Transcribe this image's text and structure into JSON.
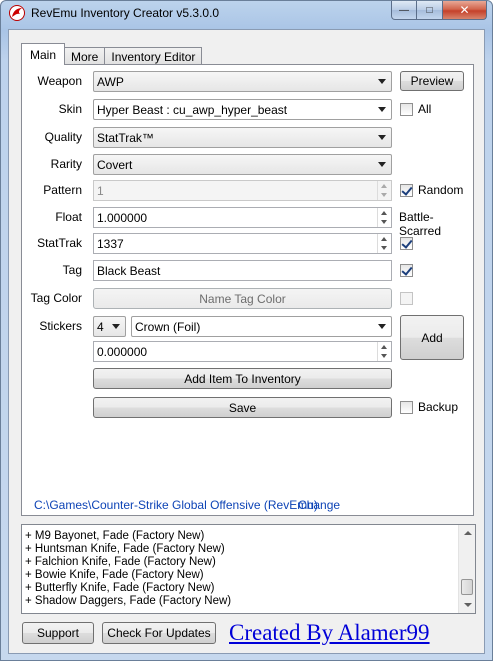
{
  "window": {
    "title": "RevEmu Inventory Creator v5.3.0.0",
    "caption": {
      "minimize": "—",
      "maximize": "□",
      "close": "✕"
    }
  },
  "tabs": [
    {
      "label": "Main",
      "active": true
    },
    {
      "label": "More",
      "active": false
    },
    {
      "label": "Inventory Editor",
      "active": false
    }
  ],
  "form": {
    "weapon": {
      "label": "Weapon",
      "value": "AWP",
      "preview_label": "Preview"
    },
    "skin": {
      "label": "Skin",
      "value": "Hyper Beast : cu_awp_hyper_beast",
      "all_label": "All",
      "all_checked": false
    },
    "quality": {
      "label": "Quality",
      "value": "StatTrak™"
    },
    "rarity": {
      "label": "Rarity",
      "value": "Covert"
    },
    "pattern": {
      "label": "Pattern",
      "value": "1",
      "random_label": "Random",
      "random_checked": true
    },
    "float": {
      "label": "Float",
      "value": "1.000000",
      "wear_label": "Battle-Scarred"
    },
    "stattrak": {
      "label": "StatTrak",
      "value": "1337",
      "checked": true
    },
    "tag": {
      "label": "Tag",
      "value": "Black Beast",
      "checked": true
    },
    "tag_color": {
      "label": "Tag Color",
      "button_label": "Name Tag Color",
      "checked": false
    },
    "stickers": {
      "label": "Stickers",
      "count": "4",
      "name": "Crown (Foil)",
      "wear": "0.000000",
      "add_label": "Add"
    },
    "add_item_label": "Add Item To Inventory",
    "save_label": "Save",
    "backup_label": "Backup",
    "backup_checked": false
  },
  "path": {
    "value": "C:\\Games\\Counter-Strike Global Offensive (RevEmu)",
    "change_label": "Change"
  },
  "inventory_list": [
    "+ M9 Bayonet, Fade (Factory New)",
    "+ Huntsman Knife, Fade (Factory New)",
    "+ Falchion Knife, Fade (Factory New)",
    "+ Bowie Knife, Fade (Factory New)",
    "+ Butterfly Knife, Fade (Factory New)",
    "+ Shadow Daggers, Fade (Factory New)"
  ],
  "footer": {
    "support_label": "Support",
    "updates_label": "Check For Updates",
    "credit": "Created By Alamer99"
  },
  "colors": {
    "link": "#0e44b6",
    "credit": "#0000d8",
    "close_button": "#c5412a"
  }
}
